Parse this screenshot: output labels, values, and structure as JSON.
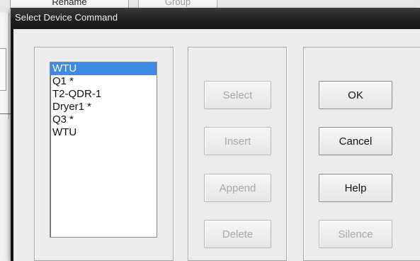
{
  "background_window": {
    "rename_label": "Rename",
    "group_label": "Group"
  },
  "dialog": {
    "title": "Select Device Command",
    "device_list": {
      "items": [
        {
          "label": "WTU",
          "selected": true
        },
        {
          "label": "Q1 *",
          "selected": false
        },
        {
          "label": "T2-QDR-1",
          "selected": false
        },
        {
          "label": "Dryer1 *",
          "selected": false
        },
        {
          "label": "Q3 *",
          "selected": false
        },
        {
          "label": "WTU",
          "selected": false
        }
      ]
    },
    "action_buttons": {
      "select": {
        "label": "Select",
        "enabled": false
      },
      "insert": {
        "label": "Insert",
        "enabled": false
      },
      "append": {
        "label": "Append",
        "enabled": false
      },
      "delete": {
        "label": "Delete",
        "enabled": false
      }
    },
    "dialog_buttons": {
      "ok": {
        "label": "OK",
        "enabled": true
      },
      "cancel": {
        "label": "Cancel",
        "enabled": true
      },
      "help": {
        "label": "Help",
        "enabled": true
      },
      "silence": {
        "label": "Silence",
        "enabled": false
      }
    }
  },
  "colors": {
    "selection": "#3f8ae3",
    "title_bar": "#1e1e1e",
    "disabled_text": "#a8a8a8"
  }
}
